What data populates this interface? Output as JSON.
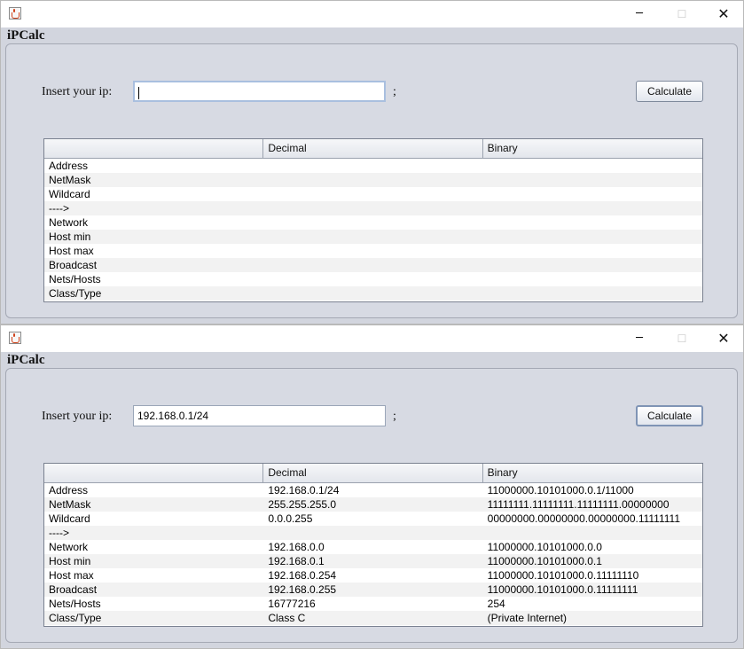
{
  "windows": [
    {
      "title": "iPCalc",
      "ip_label": "Insert your ip:",
      "ip_value": "",
      "semicolon": ";",
      "calculate_label": "Calculate",
      "columns": [
        "",
        "Decimal",
        "Binary"
      ],
      "rows": [
        [
          "Address",
          "",
          ""
        ],
        [
          "NetMask",
          "",
          ""
        ],
        [
          "Wildcard",
          "",
          ""
        ],
        [
          "---->",
          "",
          ""
        ],
        [
          "Network",
          "",
          ""
        ],
        [
          "Host min",
          "",
          ""
        ],
        [
          "Host max",
          "",
          ""
        ],
        [
          "Broadcast",
          "",
          ""
        ],
        [
          "Nets/Hosts",
          "",
          ""
        ],
        [
          "Class/Type",
          "",
          ""
        ]
      ]
    },
    {
      "title": "iPCalc",
      "ip_label": "Insert your ip:",
      "ip_value": "192.168.0.1/24",
      "semicolon": ";",
      "calculate_label": "Calculate",
      "columns": [
        "",
        "Decimal",
        "Binary"
      ],
      "rows": [
        [
          "Address",
          "192.168.0.1/24",
          "11000000.10101000.0.1/11000"
        ],
        [
          "NetMask",
          "255.255.255.0",
          "11111111.11111111.11111111.00000000"
        ],
        [
          "Wildcard",
          "0.0.0.255",
          "00000000.00000000.00000000.11111111"
        ],
        [
          "---->",
          "",
          ""
        ],
        [
          "Network",
          "192.168.0.0",
          "11000000.10101000.0.0"
        ],
        [
          "Host min",
          "192.168.0.1",
          "11000000.10101000.0.1"
        ],
        [
          "Host max",
          "192.168.0.254",
          "11000000.10101000.0.11111110"
        ],
        [
          "Broadcast",
          "192.168.0.255",
          "11000000.10101000.0.11111111"
        ],
        [
          "Nets/Hosts",
          "16777216",
          "254"
        ],
        [
          "Class/Type",
          "Class C",
          "(Private Internet)"
        ]
      ]
    }
  ],
  "icons": {
    "app_icon": "java-cup-icon",
    "minimize": "minimize-icon",
    "maximize": "maximize-icon",
    "close": "close-icon"
  },
  "colors": {
    "panel_bg": "#d7dae3",
    "focus_border": "#a9bfdf"
  }
}
